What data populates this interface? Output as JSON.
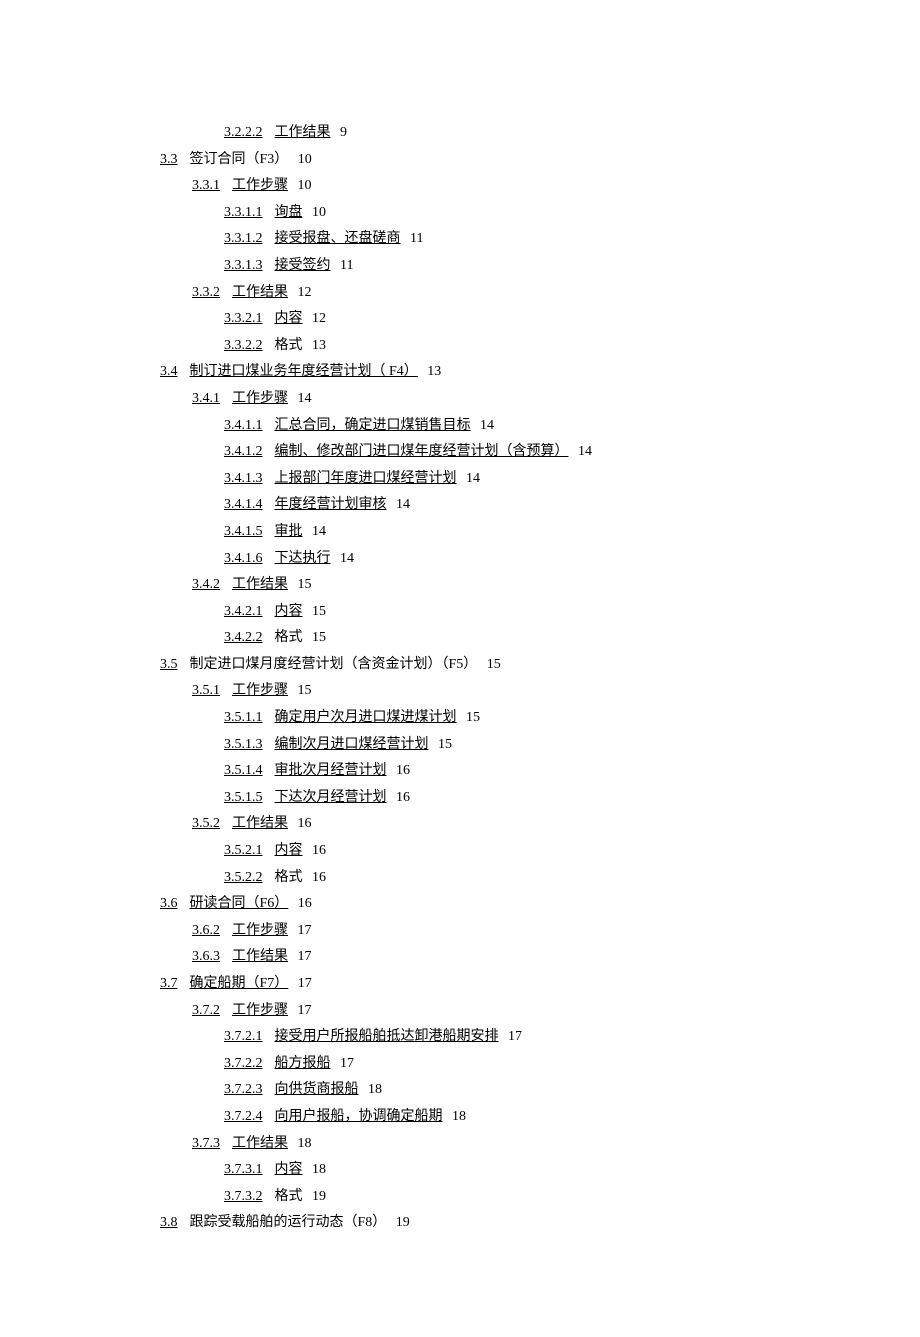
{
  "toc": [
    {
      "level": 4,
      "num": "3.2.2.2",
      "title": "工作结果",
      "page": "9",
      "link": true
    },
    {
      "level": 2,
      "num": "3.3",
      "title": "签订合同（F3）",
      "page": "10",
      "link": false
    },
    {
      "level": 3,
      "num": "3.3.1",
      "title": "工作步骤",
      "page": "10",
      "link": true
    },
    {
      "level": 4,
      "num": "3.3.1.1",
      "title": "询盘",
      "page": "10",
      "link": true
    },
    {
      "level": 4,
      "num": "3.3.1.2",
      "title": "接受报盘、还盘磋商",
      "page": "11",
      "link": true
    },
    {
      "level": 4,
      "num": "3.3.1.3",
      "title": "接受签约",
      "page": "11",
      "link": true
    },
    {
      "level": 3,
      "num": "3.3.2",
      "title": "工作结果",
      "page": "12",
      "link": true
    },
    {
      "level": 4,
      "num": "3.3.2.1",
      "title": "内容",
      "page": "12",
      "link": true
    },
    {
      "level": 4,
      "num": "3.3.2.2",
      "title": "格式",
      "page": "13",
      "link": false
    },
    {
      "level": 2,
      "num": "3.4",
      "title": "制订进口煤业务年度经营计划（ F4）",
      "page": "13",
      "link": true
    },
    {
      "level": 3,
      "num": "3.4.1",
      "title": "工作步骤",
      "page": "14",
      "link": true
    },
    {
      "level": 4,
      "num": "3.4.1.1",
      "title": "汇总合同，确定进口煤销售目标",
      "page": "14",
      "link": true
    },
    {
      "level": 4,
      "num": "3.4.1.2",
      "title": "编制、修改部门进口煤年度经营计划（含预算）",
      "page": "14",
      "link": true
    },
    {
      "level": 4,
      "num": "3.4.1.3",
      "title": "上报部门年度进口煤经营计划",
      "page": "14",
      "link": true
    },
    {
      "level": 4,
      "num": "3.4.1.4",
      "title": "年度经营计划审核",
      "page": "14",
      "link": true
    },
    {
      "level": 4,
      "num": "3.4.1.5",
      "title": "审批",
      "page": "14",
      "link": true
    },
    {
      "level": 4,
      "num": "3.4.1.6",
      "title": "下达执行",
      "page": "14",
      "link": true
    },
    {
      "level": 3,
      "num": "3.4.2",
      "title": "工作结果",
      "page": "15",
      "link": true
    },
    {
      "level": 4,
      "num": "3.4.2.1",
      "title": "内容",
      "page": "15",
      "link": true
    },
    {
      "level": 4,
      "num": "3.4.2.2",
      "title": "格式",
      "page": "15",
      "link": false
    },
    {
      "level": 2,
      "num": "3.5",
      "title": "制定进口煤月度经营计划（含资金计划）（F5）",
      "page": "15",
      "link": false
    },
    {
      "level": 3,
      "num": "3.5.1",
      "title": "工作步骤",
      "page": "15",
      "link": true
    },
    {
      "level": 4,
      "num": "3.5.1.1",
      "title": "确定用户次月进口煤进煤计划",
      "page": "15",
      "link": true
    },
    {
      "level": 4,
      "num": "3.5.1.3",
      "title": "编制次月进口煤经营计划",
      "page": "15",
      "link": true
    },
    {
      "level": 4,
      "num": "3.5.1.4",
      "title": "审批次月经营计划",
      "page": "16",
      "link": true
    },
    {
      "level": 4,
      "num": "3.5.1.5",
      "title": "下达次月经营计划",
      "page": "16",
      "link": true
    },
    {
      "level": 3,
      "num": "3.5.2",
      "title": "工作结果",
      "page": "16",
      "link": true
    },
    {
      "level": 4,
      "num": "3.5.2.1",
      "title": "内容",
      "page": "16",
      "link": true
    },
    {
      "level": 4,
      "num": "3.5.2.2",
      "title": "格式",
      "page": "16",
      "link": false
    },
    {
      "level": 2,
      "num": "3.6",
      "title": "研读合同（F6）",
      "page": "16",
      "link": true
    },
    {
      "level": 3,
      "num": "3.6.2",
      "title": "工作步骤",
      "page": "17",
      "link": true
    },
    {
      "level": 3,
      "num": "3.6.3",
      "title": "工作结果",
      "page": "17",
      "link": true
    },
    {
      "level": 2,
      "num": "3.7",
      "title": "确定船期（F7）",
      "page": "17",
      "link": true
    },
    {
      "level": 3,
      "num": "3.7.2",
      "title": "工作步骤",
      "page": "17",
      "link": true
    },
    {
      "level": 4,
      "num": "3.7.2.1",
      "title": "接受用户所报船舶抵达卸港船期安排",
      "page": "17",
      "link": true
    },
    {
      "level": 4,
      "num": "3.7.2.2",
      "title": "船方报船",
      "page": "17",
      "link": true
    },
    {
      "level": 4,
      "num": "3.7.2.3",
      "title": "向供货商报船",
      "page": "18",
      "link": true
    },
    {
      "level": 4,
      "num": "3.7.2.4",
      "title": "向用户报船，协调确定船期",
      "page": "18",
      "link": true
    },
    {
      "level": 3,
      "num": "3.7.3",
      "title": "工作结果",
      "page": "18",
      "link": true
    },
    {
      "level": 4,
      "num": "3.7.3.1",
      "title": "内容",
      "page": "18",
      "link": true
    },
    {
      "level": 4,
      "num": "3.7.3.2",
      "title": "格式",
      "page": "19",
      "link": false
    },
    {
      "level": 2,
      "num": "3.8",
      "title": "跟踪受载船舶的运行动态（F8）",
      "page": "19",
      "link": false
    }
  ]
}
